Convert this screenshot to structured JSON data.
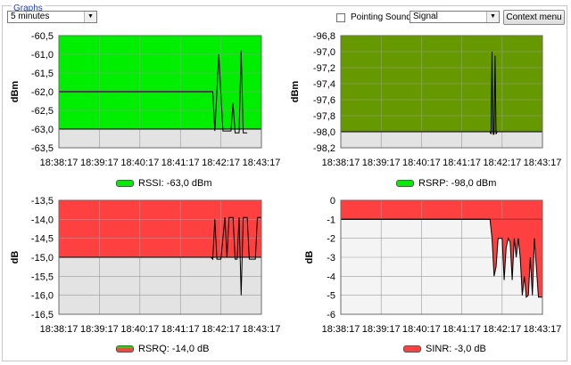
{
  "group": {
    "title": "Graphs"
  },
  "controls": {
    "time_range": "5 minutes",
    "pointing_sound_label": "Pointing Sound",
    "pointing_sound_checked": false,
    "signal_select": "Signal",
    "context_menu_label": "Context menu"
  },
  "x_ticks": [
    "18:38:17",
    "18:39:17",
    "18:40:17",
    "18:41:17",
    "18:42:17",
    "18:43:17"
  ],
  "colors": {
    "rssi": "#00ee00",
    "rsrp": "#669900",
    "rsrq": "#ff4040",
    "sinr": "#ff4040",
    "below": "#e3e3e3",
    "sinr_below": "#f4f4f4"
  },
  "legends": {
    "rssi": "RSSI: -63,0 dBm",
    "rsrp": "RSRP: -98,0 dBm",
    "rsrq": "RSRQ: -14,0 dB",
    "sinr": "SINR: -3,0 dB"
  },
  "chart_data": [
    {
      "type": "area",
      "id": "rssi",
      "ylabel": "dBm",
      "ylim": [
        -63.5,
        -60.5
      ],
      "yticks": [
        "-60,5",
        "-61,0",
        "-61,5",
        "-62,0",
        "-62,5",
        "-63,0",
        "-63,5"
      ],
      "threshold": -63.0,
      "grid": true,
      "values": [
        [
          0.0,
          -62.0
        ],
        [
          0.7,
          -62.0
        ],
        [
          0.76,
          -62.0
        ],
        [
          0.77,
          -63.05
        ],
        [
          0.78,
          -62.0
        ],
        [
          0.79,
          -61.0
        ],
        [
          0.8,
          -62.05
        ],
        [
          0.81,
          -63.05
        ],
        [
          0.85,
          -63.05
        ],
        [
          0.86,
          -62.3
        ],
        [
          0.87,
          -63.1
        ],
        [
          0.89,
          -63.1
        ],
        [
          0.9,
          -60.9
        ],
        [
          0.91,
          -63.1
        ],
        [
          0.93,
          -63.1
        ]
      ],
      "reference": {
        "y": -62.0,
        "x_end": 0.76
      }
    },
    {
      "type": "area",
      "id": "rsrp",
      "ylabel": "dBm",
      "ylim": [
        -98.2,
        -96.8
      ],
      "yticks": [
        "-96,8",
        "-97,0",
        "-97,2",
        "-97,4",
        "-97,6",
        "-97,8",
        "-98,0",
        "-98,2"
      ],
      "threshold": -98.0,
      "grid": true,
      "values": [
        [
          0.0,
          -98.0
        ],
        [
          0.74,
          -98.0
        ],
        [
          0.745,
          -98.03
        ],
        [
          0.75,
          -97.0
        ],
        [
          0.755,
          -98.03
        ],
        [
          0.76,
          -98.03
        ],
        [
          0.765,
          -97.05
        ],
        [
          0.77,
          -98.03
        ],
        [
          0.775,
          -98.0
        ],
        [
          1.0,
          -98.0
        ]
      ]
    },
    {
      "type": "area",
      "id": "rsrq",
      "ylabel": "dB",
      "ylim": [
        -16.5,
        -13.5
      ],
      "yticks": [
        "-13,5",
        "-14,0",
        "-14,5",
        "-15,0",
        "-15,5",
        "-16,0",
        "-16,5"
      ],
      "threshold": -15.0,
      "grid": true,
      "values": [
        [
          0.0,
          -15.0
        ],
        [
          0.75,
          -15.0
        ],
        [
          0.76,
          -15.05
        ],
        [
          0.77,
          -14.0
        ],
        [
          0.78,
          -15.05
        ],
        [
          0.8,
          -15.05
        ],
        [
          0.82,
          -13.95
        ],
        [
          0.83,
          -15.0
        ],
        [
          0.84,
          -13.95
        ],
        [
          0.86,
          -13.95
        ],
        [
          0.87,
          -15.05
        ],
        [
          0.88,
          -15.05
        ],
        [
          0.89,
          -13.95
        ],
        [
          0.9,
          -16.0
        ],
        [
          0.91,
          -13.95
        ],
        [
          0.93,
          -13.95
        ],
        [
          0.94,
          -15.05
        ],
        [
          0.97,
          -15.05
        ],
        [
          0.98,
          -13.95
        ],
        [
          1.0,
          -13.95
        ]
      ]
    },
    {
      "type": "area",
      "id": "sinr",
      "ylabel": "dB",
      "ylim": [
        -6,
        0
      ],
      "yticks": [
        "0",
        "-1",
        "-2",
        "-3",
        "-4",
        "-5",
        "-6"
      ],
      "threshold": -1.0,
      "grid": true,
      "values": [
        [
          0.0,
          -1.0
        ],
        [
          0.74,
          -1.0
        ],
        [
          0.75,
          -2.0
        ],
        [
          0.76,
          -4.0
        ],
        [
          0.77,
          -3.5
        ],
        [
          0.78,
          -2.0
        ],
        [
          0.8,
          -2.0
        ],
        [
          0.81,
          -4.2
        ],
        [
          0.82,
          -2.5
        ],
        [
          0.83,
          -2.0
        ],
        [
          0.84,
          -2.2
        ],
        [
          0.85,
          -4.2
        ],
        [
          0.86,
          -2.0
        ],
        [
          0.87,
          -3.0
        ],
        [
          0.88,
          -2.0
        ],
        [
          0.89,
          -3.0
        ],
        [
          0.9,
          -5.0
        ],
        [
          0.91,
          -4.0
        ],
        [
          0.92,
          -5.1
        ],
        [
          0.93,
          -5.0
        ],
        [
          0.94,
          -3.0
        ],
        [
          0.95,
          -5.0
        ],
        [
          0.96,
          -2.0
        ],
        [
          0.98,
          -5.1
        ],
        [
          1.0,
          -5.1
        ]
      ]
    }
  ]
}
